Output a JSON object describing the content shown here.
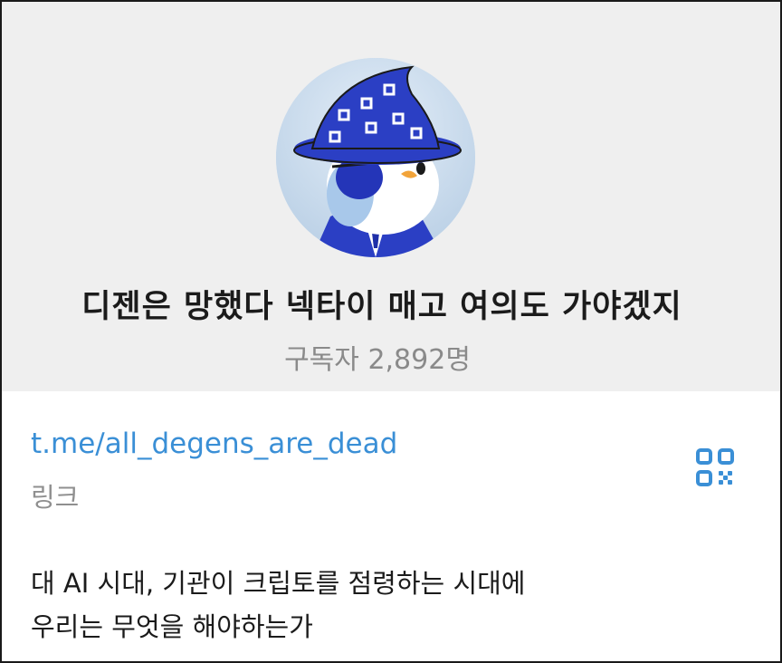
{
  "profile": {
    "channel_name": "디젠은 망했다 넥타이 매고 여의도 가야겠지",
    "subscribers_label": "구독자",
    "subscribers_count": "2,892명",
    "avatar_icon": "penguin-wizard-avatar"
  },
  "info": {
    "link": "t.me/all_degens_are_dead",
    "link_caption": "링크",
    "qr_icon": "qr-code-icon",
    "description_line1": "대 AI 시대, 기관이 크립토를 점령하는 시대에",
    "description_line2": "우리는 무엇을 해야하는가"
  },
  "colors": {
    "header_bg": "#efefef",
    "link": "#3a8fd6",
    "muted": "#8a8a8a",
    "hat_blue": "#2b3fc4"
  }
}
